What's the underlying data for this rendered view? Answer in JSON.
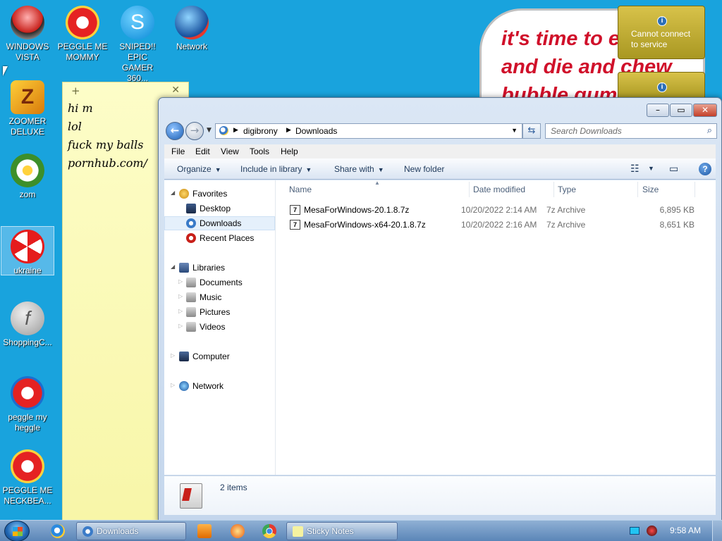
{
  "desktop": {
    "icons": [
      {
        "label": "WINDOWS\nVISTA"
      },
      {
        "label": "PEGGLE ME\nMOMMY"
      },
      {
        "label": "SNIPED!! EPIC\nGAMER 360..."
      },
      {
        "label": "Network"
      },
      {
        "label": "ZOOMER\nDELUXE"
      },
      {
        "label": "zom"
      },
      {
        "label": "ukraine"
      },
      {
        "label": "ShoppingC..."
      },
      {
        "label": "peggle my\nheggle"
      },
      {
        "label": "PEGGLE ME\nNECKBEA..."
      }
    ],
    "bubble_text": "it's time to e\nand die and chew\nbubble gum",
    "notification": "Cannot connect\nto service"
  },
  "sticky": {
    "lines": [
      "hi m",
      "lol",
      "fuck my balls",
      "pornhub.com/"
    ]
  },
  "explorer": {
    "path": [
      "digibrony",
      "Downloads"
    ],
    "search_placeholder": "Search Downloads",
    "menu": [
      "File",
      "Edit",
      "View",
      "Tools",
      "Help"
    ],
    "commands": {
      "organize": "Organize",
      "include": "Include in library",
      "share": "Share with",
      "new_folder": "New folder"
    },
    "nav": {
      "favorites": "Favorites",
      "desktop": "Desktop",
      "downloads": "Downloads",
      "recent": "Recent Places",
      "libraries": "Libraries",
      "documents": "Documents",
      "music": "Music",
      "pictures": "Pictures",
      "videos": "Videos",
      "computer": "Computer",
      "network": "Network"
    },
    "columns": {
      "name": "Name",
      "date": "Date modified",
      "type": "Type",
      "size": "Size"
    },
    "files": [
      {
        "name": "MesaForWindows-20.1.8.7z",
        "date": "10/20/2022 2:14 AM",
        "type": "7z Archive",
        "size": "6,895 KB"
      },
      {
        "name": "MesaForWindows-x64-20.1.8.7z",
        "date": "10/20/2022 2:16 AM",
        "type": "7z Archive",
        "size": "8,651 KB"
      }
    ],
    "item_count": "2 items"
  },
  "taskbar": {
    "tasks": [
      "Downloads",
      "Sticky Notes"
    ],
    "clock": "9:58 AM"
  }
}
